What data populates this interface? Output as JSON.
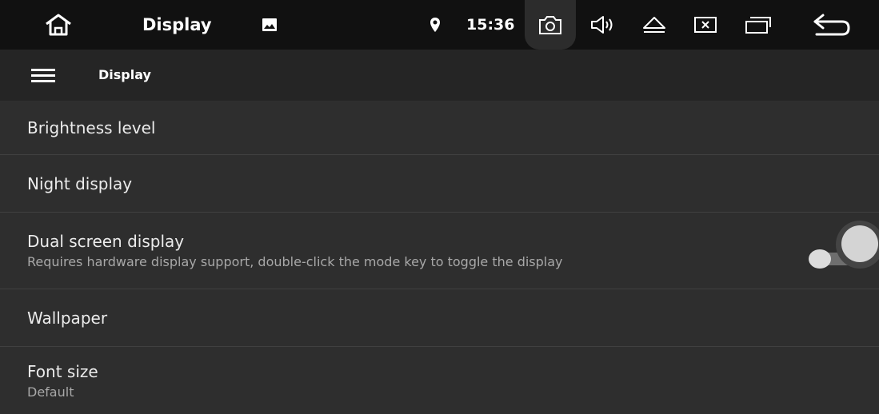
{
  "statusbar": {
    "title": "Display",
    "time": "15:36",
    "icons": [
      "home-icon",
      "image-icon",
      "location-pin-icon",
      "camera-icon",
      "volume-icon",
      "eject-icon",
      "close-box-icon",
      "recent-apps-icon",
      "back-icon"
    ]
  },
  "toolbar": {
    "title": "Display"
  },
  "settings": [
    {
      "title": "Brightness level"
    },
    {
      "title": "Night display"
    },
    {
      "title": "Dual screen display",
      "subtitle": "Requires hardware display support, double-click the mode key to toggle the display"
    },
    {
      "title": "Wallpaper"
    },
    {
      "title": "Font size",
      "subtitle": "Default"
    }
  ],
  "colors": {
    "statusbar_bg": "#111111",
    "toolbar_bg": "#252525",
    "list_bg": "#2e2e2e",
    "divider": "#404040"
  }
}
